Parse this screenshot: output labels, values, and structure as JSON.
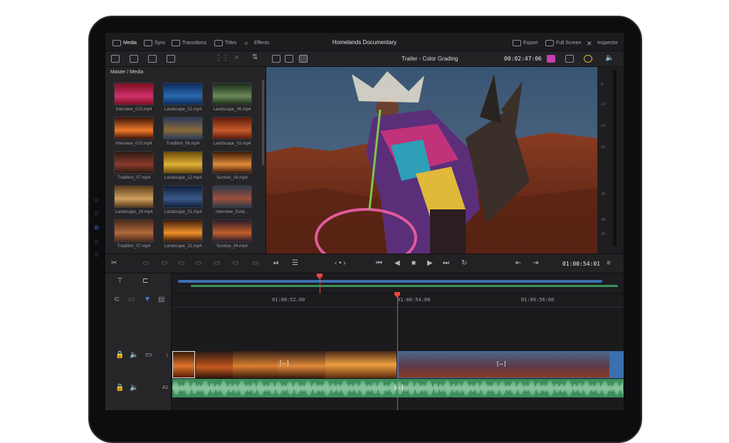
{
  "app": {
    "top_tabs": [
      {
        "label": "Media",
        "icon": "media-icon"
      },
      {
        "label": "Sync",
        "icon": "sync-icon"
      },
      {
        "label": "Transitions",
        "icon": "transitions-icon"
      },
      {
        "label": "Titles",
        "icon": "titles-icon"
      },
      {
        "label": "Effects",
        "icon": "effects-icon"
      }
    ],
    "project_title": "Homelands Documentary",
    "right_actions": [
      {
        "label": "Export",
        "icon": "export-icon"
      },
      {
        "label": "Full Screen",
        "icon": "fullscreen-icon"
      },
      {
        "label": "Inspector",
        "icon": "inspector-icon"
      }
    ]
  },
  "viewer": {
    "timeline_name": "Trailer - Color Grading",
    "source_timecode": "00:02:47:06"
  },
  "media_pool": {
    "path": "Master / Media",
    "clips": [
      {
        "name": "Interview_010.mp4"
      },
      {
        "name": "Landscape_02.mp4"
      },
      {
        "name": "Landscape_06.mp4"
      },
      {
        "name": "Interview_010.mp4"
      },
      {
        "name": "Tradition_06.mp4"
      },
      {
        "name": "Landscape_03.mp4"
      },
      {
        "name": "Tradition_07.mp4"
      },
      {
        "name": "Landscape_12.mp4"
      },
      {
        "name": "Sunrise_04.mp4"
      },
      {
        "name": "Landscape_24.mp4"
      },
      {
        "name": "Landscape_01.mp4"
      },
      {
        "name": "Interview_Dusk..."
      },
      {
        "name": "Tradition_07.mp4"
      },
      {
        "name": "Landscape_12.mp4"
      },
      {
        "name": "Sunrise_04.mp4"
      }
    ]
  },
  "meter": {
    "labels": [
      "-5",
      "-10",
      "-15",
      "-20",
      "-30",
      "-40",
      "-50"
    ]
  },
  "transport": {
    "timecode": "01:00:54:01"
  },
  "timeline": {
    "ruler_timecodes": [
      "01:00:52:00",
      "01:00:54:00",
      "01:00:56:00"
    ],
    "video_track_label": "1",
    "audio_track_label": "A1"
  },
  "colors": {
    "accent_red": "#e8453c",
    "audio_green": "#3d8f5c",
    "clip_blue": "#3c6fb0"
  }
}
